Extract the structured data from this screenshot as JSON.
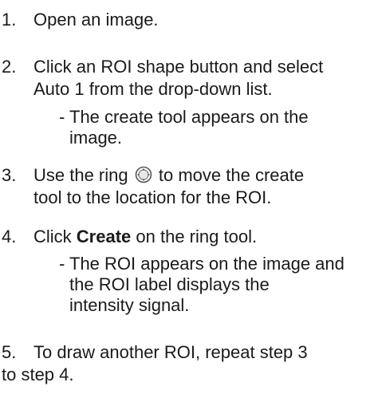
{
  "steps": [
    {
      "number": "1.",
      "text": "Open an image."
    },
    {
      "number": "2.",
      "line1": "Click an ROI shape button and select",
      "line2": "Auto 1 from the drop-down list."
    },
    {
      "number": "3.",
      "before_icon": "Use the ring",
      "after_icon": "to move the create",
      "line2": "tool to the location for the ROI.",
      "icon": "ring-icon"
    },
    {
      "number": "4.",
      "before_bold": "Click",
      "bold": "Create",
      "after_bold": "on the ring tool."
    },
    {
      "number": "5.",
      "line1": "To draw another ROI, repeat step 3",
      "line2": "to step 4."
    }
  ],
  "notes": {
    "step2": {
      "dash": "-",
      "line1": "The create tool appears on the",
      "line2": "image."
    },
    "step4": {
      "dash": "-",
      "line1": "The ROI appears on the image and",
      "line2": "the ROI label displays the",
      "line3": "intensity signal."
    }
  }
}
